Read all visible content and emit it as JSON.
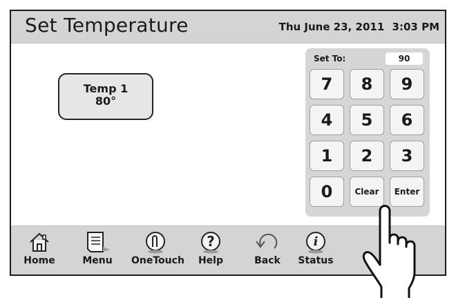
{
  "header": {
    "title": "Set Temperature",
    "date": "Thu June 23, 2011",
    "time": "3:03 PM"
  },
  "zone": {
    "name": "Temp 1",
    "value": "80°"
  },
  "keypad": {
    "set_to_label": "Set To:",
    "set_to_value": "90",
    "keys": [
      "7",
      "8",
      "9",
      "4",
      "5",
      "6",
      "1",
      "2",
      "3",
      "0",
      "Clear",
      "Enter"
    ]
  },
  "nav": {
    "items": [
      {
        "label": "Home",
        "icon": "home-icon"
      },
      {
        "label": "Menu",
        "icon": "menu-icon"
      },
      {
        "label": "OneTouch",
        "icon": "onetouch-icon"
      },
      {
        "label": "Help",
        "icon": "help-icon"
      },
      {
        "label": "Back",
        "icon": "back-icon"
      },
      {
        "label": "Status",
        "icon": "status-icon"
      }
    ]
  },
  "colors": {
    "bar": "#d4d4d4",
    "keypad": "#d6d6d6",
    "key": "#f4f4f4",
    "text": "#1a1a1a"
  }
}
